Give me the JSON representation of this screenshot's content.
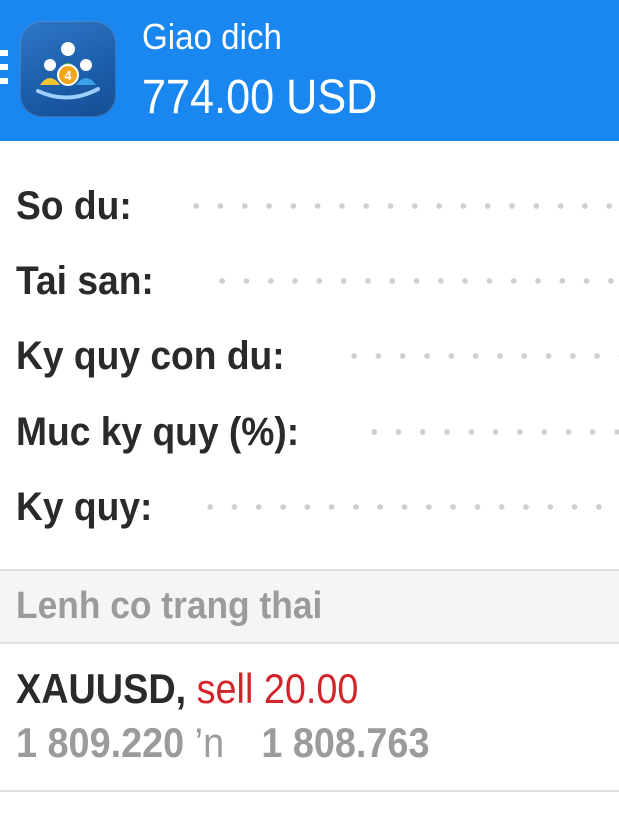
{
  "header": {
    "title": "Giao dich",
    "balance": "774.00 USD",
    "logo_badge": "4",
    "background_color": "#1a86f0"
  },
  "account": {
    "rows": [
      {
        "label": "So du:"
      },
      {
        "label": "Tai san:"
      },
      {
        "label": "Ky quy con du:"
      },
      {
        "label": "Muc ky quy (%):"
      },
      {
        "label": "Ky quy:"
      }
    ]
  },
  "positions": {
    "section_title": "Lenh co trang thai",
    "orders": [
      {
        "symbol": "XAUUSD,",
        "type_volume": "sell 20.00",
        "open_price": "1 809.220",
        "arrow": "’n",
        "current_price": "1 808.763",
        "type_color": "#d2242b"
      }
    ]
  }
}
